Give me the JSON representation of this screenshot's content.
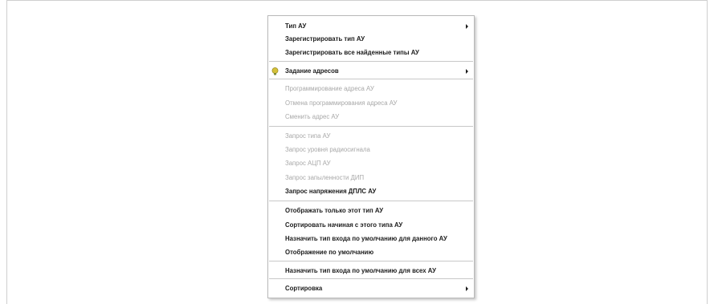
{
  "menu": {
    "type_au": "Тип АУ",
    "register_type": "Зарегистрировать тип АУ",
    "register_all": "Зарегистрировать все найденные типы АУ",
    "addr_assign": "Задание адресов",
    "prog_addr": "Программирование адреса АУ",
    "cancel_prog": "Отмена программирования адреса АУ",
    "change_addr": "Сменить адрес АУ",
    "req_type": "Запрос типа АУ",
    "req_radio": "Запрос уровня радиосигнала",
    "req_adc": "Запрос АЦП АУ",
    "req_dust": "Запрос запыленности ДИП",
    "req_voltage": "Запрос напряжения ДПЛС АУ",
    "show_only": "Отображать только этот тип АУ",
    "sort_from": "Сортировать начиная с этого типа АУ",
    "assign_input_this": "Назначить тип входа по умолчанию для данного АУ",
    "default_display": "Отображение по умолчанию",
    "assign_input_all": "Назначить тип входа по умолчанию для всех АУ",
    "sorting": "Сортировка"
  },
  "colors": {
    "text": "#1c1c1c",
    "disabled_text": "#a8a8a8",
    "separator": "#c8c8c8",
    "address_icon": "#c9b83a"
  },
  "icons": {
    "address_item": "yellow-bulb-icon",
    "submenu": "submenu-arrow-icon"
  }
}
